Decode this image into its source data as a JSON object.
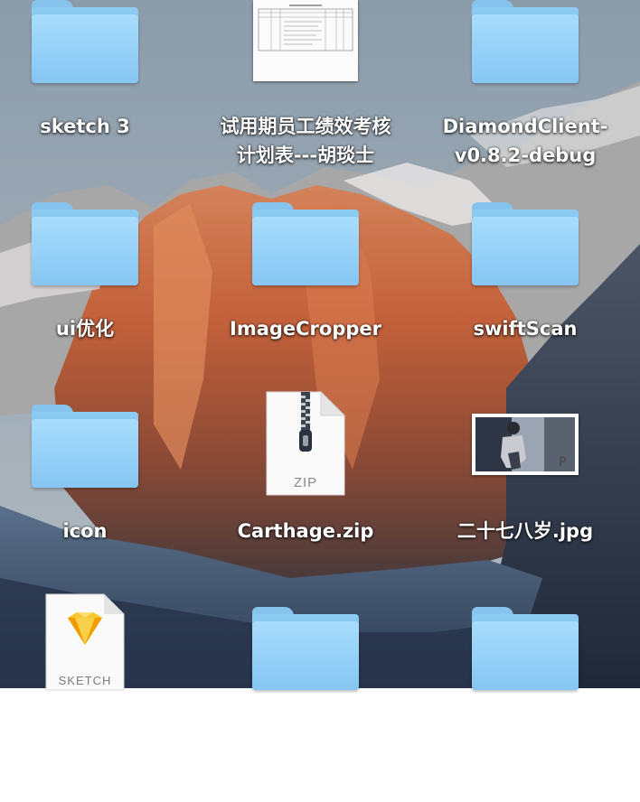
{
  "desktop": {
    "items": [
      {
        "label_lines": [
          "sketch 3"
        ],
        "kind": "folder"
      },
      {
        "label_lines": [
          "试用期员工绩效考核",
          "计划表---胡琰士"
        ],
        "kind": "document"
      },
      {
        "label_lines": [
          "DiamondClient-",
          "v0.8.2-debug"
        ],
        "kind": "folder"
      },
      {
        "label_lines": [
          "ui优化"
        ],
        "kind": "folder"
      },
      {
        "label_lines": [
          "ImageCropper"
        ],
        "kind": "folder"
      },
      {
        "label_lines": [
          "swiftScan"
        ],
        "kind": "folder"
      },
      {
        "label_lines": [
          "icon"
        ],
        "kind": "folder"
      },
      {
        "label_lines": [
          "Carthage.zip"
        ],
        "kind": "zip",
        "badge": "ZIP"
      },
      {
        "label_lines": [
          "二十七八岁.jpg"
        ],
        "kind": "image"
      },
      {
        "label_lines": [],
        "kind": "sketch",
        "badge": "SKETCH"
      },
      {
        "label_lines": [],
        "kind": "folder"
      },
      {
        "label_lines": [],
        "kind": "folder"
      }
    ]
  },
  "icons": {
    "folder": "folder-icon",
    "document": "document-icon",
    "zip": "zip-archive-icon",
    "image": "image-thumbnail-icon",
    "sketch": "sketch-file-icon"
  },
  "colors": {
    "folder_light": "#a8dcfb",
    "folder_dark": "#86c6f2",
    "label_text": "#ffffff",
    "sketch_gem": "#f7b500"
  }
}
